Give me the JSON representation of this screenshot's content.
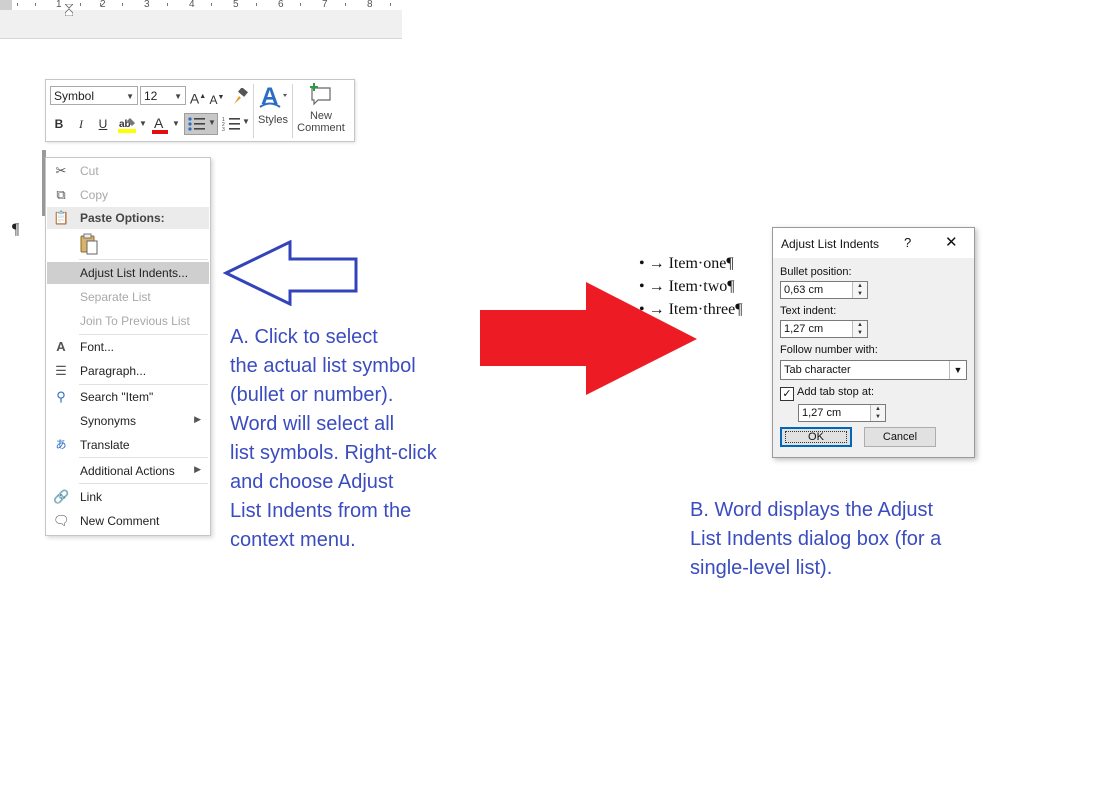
{
  "ruler": {
    "numbers": [
      "1",
      "2",
      "3",
      "4",
      "5",
      "6",
      "7",
      "8"
    ]
  },
  "mini_toolbar": {
    "font_name": "Symbol",
    "font_size": "12",
    "grow_font": "A",
    "shrink_font": "A",
    "bold": "B",
    "italic": "I",
    "underline": "U",
    "font_color_letter": "A",
    "styles_label": "Styles",
    "new_comment_line1": "New",
    "new_comment_line2": "Comment"
  },
  "context_menu": {
    "cut": "Cut",
    "copy": "Copy",
    "paste_options": "Paste Options:",
    "adjust_list_indents": "Adjust List Indents...",
    "separate_list": "Separate List",
    "join_previous_list": "Join To Previous List",
    "font": "Font...",
    "paragraph": "Paragraph...",
    "search": "Search \"Item\"",
    "synonyms": "Synonyms",
    "translate": "Translate",
    "additional_actions": "Additional Actions",
    "link": "Link",
    "new_comment": "New Comment"
  },
  "document": {
    "pilcrow": "¶"
  },
  "caption_a": [
    "A. Click to select",
    "the actual list symbol",
    "(bullet or number).",
    "Word will select all",
    "list symbols. Right-click",
    "and choose Adjust",
    "List Indents from the",
    "context menu."
  ],
  "sample_list": [
    "• → Item·one¶",
    "• → Item·two¶",
    "• → Item·three¶"
  ],
  "dialog": {
    "title": "Adjust List Indents",
    "help": "?",
    "close": "✕",
    "bullet_position_label": "Bullet position:",
    "bullet_position_value": "0,63 cm",
    "text_indent_label": "Text indent:",
    "text_indent_value": "1,27 cm",
    "follow_number_label": "Follow number with:",
    "follow_number_value": "Tab character",
    "add_tab_stop_label": "Add tab stop at:",
    "add_tab_stop_checked": "✓",
    "tab_stop_value": "1,27 cm",
    "ok": "OK",
    "cancel": "Cancel"
  },
  "caption_b": [
    "B. Word displays the Adjust",
    "List Indents dialog box (for a",
    "single-level list)."
  ],
  "colors": {
    "caption": "#3b4cc0",
    "red_arrow": "#ed1c24",
    "blue_arrow": "#3344bb"
  }
}
